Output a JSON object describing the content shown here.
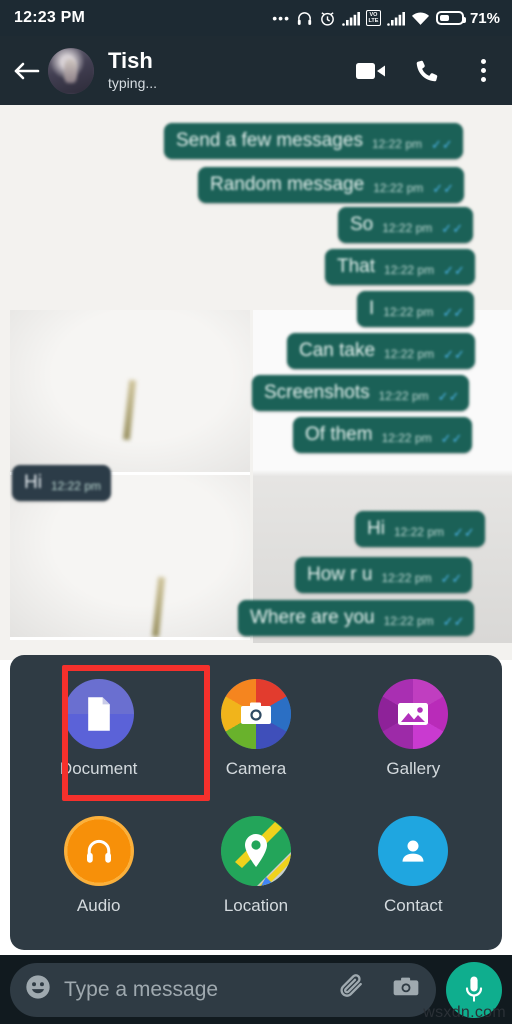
{
  "status_bar": {
    "clock": "12:23 PM",
    "battery_percent": "71%",
    "icons": [
      "more-dots-icon",
      "headphones-icon",
      "alarm-clock-icon",
      "signal-bars-icon",
      "volte-badge-icon",
      "signal-bars-2-icon",
      "wifi-icon",
      "battery-icon"
    ],
    "volte_top": "VO",
    "volte_bottom": "LTE",
    "dots": "•••"
  },
  "app_bar": {
    "back_icon": "back-arrow-icon",
    "contact_name": "Tish",
    "contact_status": "typing...",
    "video_call_icon": "video-call-icon",
    "voice_call_icon": "phone-call-icon",
    "overflow_icon": "overflow-menu-icon"
  },
  "chat": {
    "messages": [
      {
        "text": "Send a few messages",
        "time": "12:22 pm",
        "side": "out"
      },
      {
        "text": "Random message",
        "time": "12:22 pm",
        "side": "out"
      },
      {
        "text": "So",
        "time": "12:22 pm",
        "side": "out"
      },
      {
        "text": "That",
        "time": "12:22 pm",
        "side": "out"
      },
      {
        "text": "I",
        "time": "12:22 pm",
        "side": "out"
      },
      {
        "text": "Can take",
        "time": "12:22 pm",
        "side": "out"
      },
      {
        "text": "Screenshots",
        "time": "12:22 pm",
        "side": "out"
      },
      {
        "text": "Of them",
        "time": "12:22 pm",
        "side": "out"
      },
      {
        "text": "Hi",
        "time": "12:22 pm",
        "side": "out"
      },
      {
        "text": "How r u",
        "time": "12:22 pm",
        "side": "out"
      },
      {
        "text": "Where are you",
        "time": "12:22 pm",
        "side": "out"
      }
    ],
    "overlay_bubble": {
      "text": "Hi",
      "time": "12:22 pm"
    },
    "tick_glyph": "✓✓"
  },
  "attachment_sheet": {
    "items": [
      {
        "label": "Document",
        "icon": "document-icon",
        "color": "#5b62d8",
        "highlighted": true
      },
      {
        "label": "Camera",
        "icon": "camera-icon",
        "color": "#e23c2e",
        "highlighted": false
      },
      {
        "label": "Gallery",
        "icon": "gallery-icon",
        "color": "#b92bb9",
        "highlighted": false
      },
      {
        "label": "Audio",
        "icon": "headphones-icon",
        "color": "#f79009",
        "highlighted": false
      },
      {
        "label": "Location",
        "icon": "location-pin-icon",
        "color": "#23a55a",
        "highlighted": false
      },
      {
        "label": "Contact",
        "icon": "contact-person-icon",
        "color": "#1fa6e0",
        "highlighted": false
      }
    ],
    "highlight_color": "#f5302c"
  },
  "input_bar": {
    "emoji_icon": "emoji-smiley-icon",
    "placeholder": "Type a message",
    "value": "",
    "attach_icon": "paperclip-icon",
    "camera_icon": "camera-icon",
    "mic_icon": "microphone-icon",
    "mic_color": "#0fae8e"
  },
  "watermark": {
    "text": "wsxdn.com"
  }
}
